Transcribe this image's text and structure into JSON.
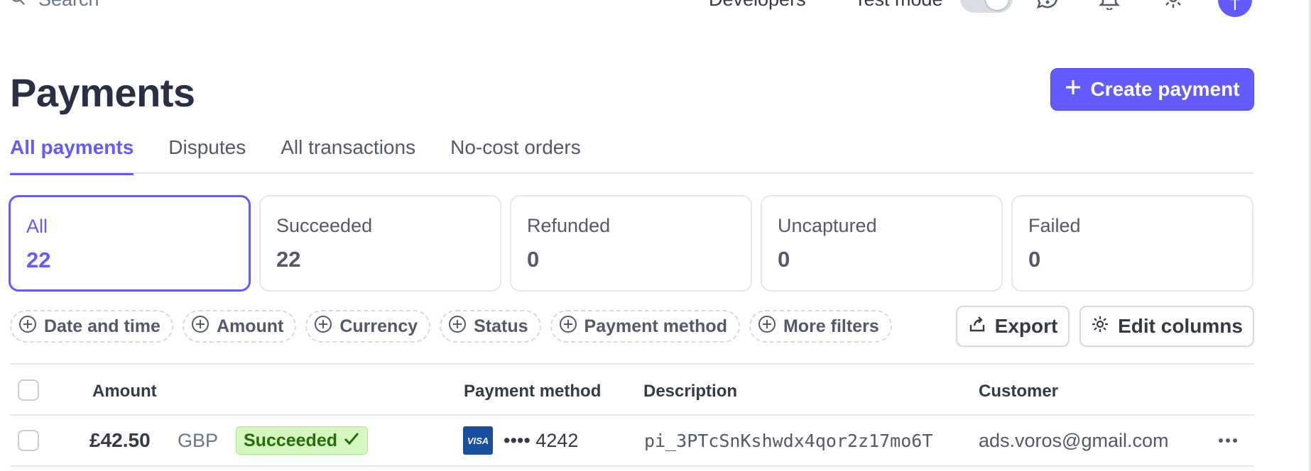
{
  "topbar": {
    "search_placeholder": "Search",
    "developers_label": "Developers",
    "test_mode_label": "Test mode",
    "test_mode_on": false,
    "avatar_initial": "T",
    "accent_color": "#635bff"
  },
  "header": {
    "title": "Payments",
    "create_button_label": "Create payment"
  },
  "tabs": [
    {
      "label": "All payments",
      "active": true
    },
    {
      "label": "Disputes",
      "active": false
    },
    {
      "label": "All transactions",
      "active": false
    },
    {
      "label": "No-cost orders",
      "active": false
    }
  ],
  "status_cards": [
    {
      "label": "All",
      "count": "22",
      "active": true
    },
    {
      "label": "Succeeded",
      "count": "22",
      "active": false
    },
    {
      "label": "Refunded",
      "count": "0",
      "active": false
    },
    {
      "label": "Uncaptured",
      "count": "0",
      "active": false
    },
    {
      "label": "Failed",
      "count": "0",
      "active": false
    }
  ],
  "filters": [
    {
      "label": "Date and time",
      "icon": "plus-circle-icon"
    },
    {
      "label": "Amount",
      "icon": "plus-circle-icon"
    },
    {
      "label": "Currency",
      "icon": "plus-circle-icon"
    },
    {
      "label": "Status",
      "icon": "plus-circle-icon"
    },
    {
      "label": "Payment method",
      "icon": "plus-circle-icon"
    },
    {
      "label": "More filters",
      "icon": "plus-circle-icon"
    }
  ],
  "actions": {
    "export_label": "Export",
    "edit_columns_label": "Edit columns"
  },
  "table": {
    "columns": [
      "Amount",
      "Payment method",
      "Description",
      "Customer"
    ],
    "rows": [
      {
        "amount": "£42.50",
        "currency": "GBP",
        "status": "Succeeded",
        "card_brand": "VISA",
        "card_masked": "•••• 4242",
        "description": "pi_3PTcSnKshwdx4qor2z17mo6T",
        "customer": "ads.voros@gmail.com"
      }
    ]
  },
  "colors": {
    "success_bg": "#d7f7c2",
    "success_text": "#217005",
    "visa_blue": "#1a4fa0"
  }
}
